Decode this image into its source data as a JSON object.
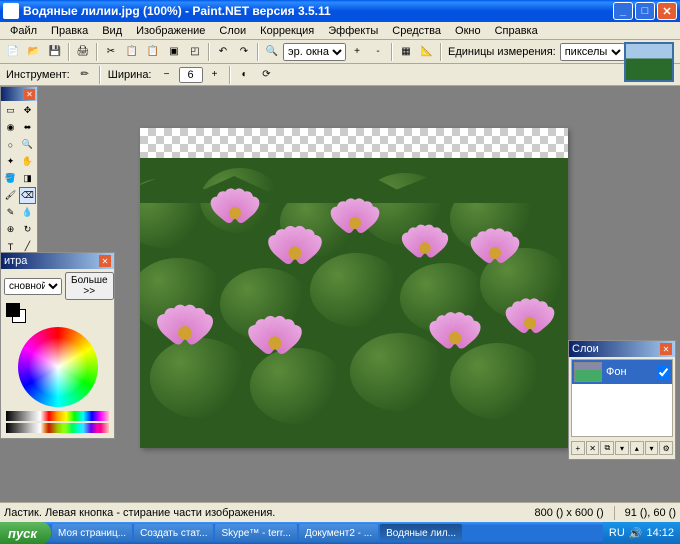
{
  "titlebar": {
    "text": "Водяные лилии.jpg (100%) - Paint.NET версия 3.5.11"
  },
  "menu": {
    "file": "Файл",
    "edit": "Правка",
    "view": "Вид",
    "image": "Изображение",
    "layers": "Слои",
    "correction": "Коррекция",
    "effects": "Эффекты",
    "tools": "Средства",
    "window": "Окно",
    "help": "Справка"
  },
  "toolbar2": {
    "window_label": "эр. окна",
    "units_label": "Единицы измерения:",
    "units_value": "пикселы"
  },
  "tool_options": {
    "label": "Инструмент:",
    "width_label": "Ширина:",
    "width_value": "6"
  },
  "colors": {
    "title": "итра",
    "primary_label": "сновной",
    "more_btn": "Больше >>",
    "primary": "#000000",
    "secondary": "#ffffff"
  },
  "layers": {
    "title": "Слои",
    "items": [
      {
        "name": "Фон",
        "visible": true
      }
    ]
  },
  "status": {
    "tool_hint": "Ластик. Левая кнопка - стирание части изображения.",
    "canvas_size": "800 () x 600 ()",
    "cursor_pos": "91 (), 60 ()"
  },
  "taskbar": {
    "start": "пуск",
    "items": [
      "Моя страниц...",
      "Создать стат...",
      "Skype™ - terr...",
      "Документ2 - ...",
      "Водяные лил..."
    ],
    "lang": "RU",
    "time": "14:12"
  }
}
